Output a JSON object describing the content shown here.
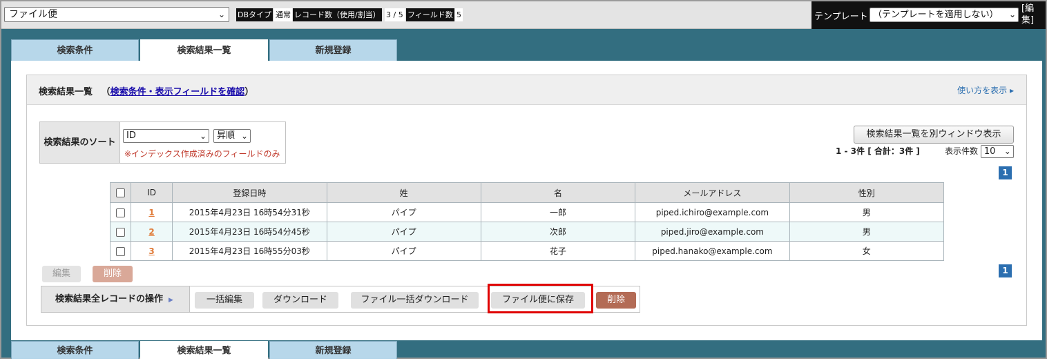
{
  "topbar": {
    "db_name": "ファイル便",
    "meta": [
      {
        "key": "DBタイプ",
        "value": "通常"
      },
      {
        "key": "レコード数（使用/割当）",
        "value": "3 / 5"
      },
      {
        "key": "フィールド数",
        "value": "5"
      }
    ],
    "template_label": "テンプレート",
    "template_value": "（テンプレートを適用しない）",
    "template_edit": "[編集]"
  },
  "tabs": [
    "検索条件",
    "検索結果一覧",
    "新規登録"
  ],
  "header": {
    "title": "検索結果一覧",
    "paren_open": "（",
    "link": "検索条件・表示フィールドを確認",
    "paren_close": "）",
    "howto": "使い方を表示 ▸"
  },
  "sort": {
    "label": "検索結果のソート",
    "field": "ID",
    "order": "昇順",
    "note": "※インデックス作成済みのフィールドのみ"
  },
  "open_window_label": "検索結果一覧を別ウィンドウ表示",
  "count_text": "1 - 3件 [ 合計：3件 ]",
  "per_page_label": "表示件数",
  "per_page_value": "10",
  "page": "1",
  "table": {
    "headers": [
      "ID",
      "登録日時",
      "姓",
      "名",
      "メールアドレス",
      "性別"
    ],
    "rows": [
      {
        "id": "1",
        "date": "2015年4月23日 16時54分31秒",
        "last": "パイプ",
        "first": "一郎",
        "email": "piped.ichiro@example.com",
        "sex": "男"
      },
      {
        "id": "2",
        "date": "2015年4月23日 16時54分45秒",
        "last": "パイプ",
        "first": "次郎",
        "email": "piped.jiro@example.com",
        "sex": "男"
      },
      {
        "id": "3",
        "date": "2015年4月23日 16時55分03秒",
        "last": "パイプ",
        "first": "花子",
        "email": "piped.hanako@example.com",
        "sex": "女"
      }
    ]
  },
  "row_actions": {
    "edit": "編集",
    "delete": "削除"
  },
  "ops": {
    "label": "検索結果全レコードの操作",
    "bulk_edit": "一括編集",
    "download": "ダウンロード",
    "file_bulk_download": "ファイル一括ダウンロード",
    "save_to_filebin": "ファイル便に保存",
    "delete": "削除"
  },
  "colors": {
    "tab_bg": "#b7d7ea",
    "frame_bg": "#336e80",
    "delete_btn": "#b36b55",
    "highlight": "#e00000"
  }
}
